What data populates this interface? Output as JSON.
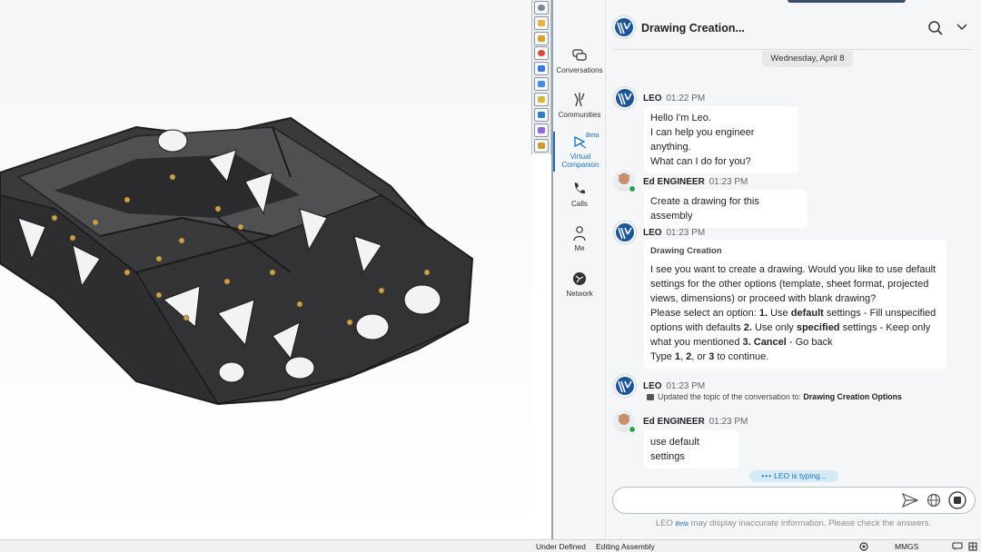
{
  "colors": {
    "accent": "#1f6fb8",
    "logo": "#1c5598",
    "online": "#2ea44f",
    "bubble": "#ffffff",
    "panel": "#f5f6f7"
  },
  "taskbar": {
    "icons": [
      "home-icon",
      "folder-icon",
      "parts-icon",
      "appearance-icon",
      "view-icon",
      "display-icon",
      "custom-props-icon",
      "house-icon",
      "tools-icon",
      "library-icon"
    ]
  },
  "nav": {
    "items": [
      {
        "label": "Conversations",
        "icon": "chat-icon"
      },
      {
        "label": "Communities",
        "icon": "communities-icon"
      },
      {
        "label_line1": "Virtual",
        "label_line2": "Companion",
        "icon": "companion-icon",
        "badge": "Beta"
      },
      {
        "label": "Calls",
        "icon": "phone-icon"
      },
      {
        "label": "Me",
        "icon": "person-icon"
      },
      {
        "label": "Network",
        "icon": "network-icon"
      }
    ]
  },
  "header": {
    "title": "Drawing Creation...",
    "search_icon": "search-icon",
    "menu_icon": "chevron-down-icon"
  },
  "date_divider": "Wednesday, April 8",
  "messages": [
    {
      "sender": "LEO",
      "time": "01:22 PM",
      "lines": [
        "Hello I'm Leo.",
        "I can help you engineer anything.",
        "What can I do for you?"
      ]
    },
    {
      "sender": "Ed ENGINEER",
      "time": "01:23 PM",
      "text": "Create a drawing for this assembly"
    },
    {
      "sender": "LEO",
      "time": "01:23 PM",
      "label": "Drawing Creation",
      "p1": "I see you want to create a drawing. Would you like to use default settings for the other options (template, sheet format, projected views, dimensions) or proceed with blank drawing?",
      "p2a": "Please select an option: ",
      "p2b": "1.",
      "p2c": " Use ",
      "p2d": "default",
      "p2e": " settings - Fill unspecified options with defaults ",
      "p2f": "2.",
      "p2g": " Use only ",
      "p2h": "specified",
      "p2i": " settings - Keep only what you mentioned ",
      "p2j": "3. Cancel",
      "p2k": " - Go back",
      "p3a": "Type ",
      "p3b": "1",
      "p3c": ", ",
      "p3d": "2",
      "p3e": ", or ",
      "p3f": "3",
      "p3g": " to continue."
    },
    {
      "sender": "LEO",
      "time": "01:23 PM",
      "topic_prefix": "Updated the topic of the conversation to: ",
      "topic": "Drawing Creation Options"
    },
    {
      "sender": "Ed ENGINEER",
      "time": "01:23 PM",
      "text": "use default settings"
    }
  ],
  "typing": {
    "dots": "•••",
    "text": "LEO is typing..."
  },
  "input": {
    "placeholder": ""
  },
  "disclaimer": {
    "name": "LEO",
    "badge": "Beta",
    "text": " may display inaccurate information. Please check the answers."
  },
  "status": {
    "state": "Under Defined",
    "mode": "Editing Assembly",
    "units": "MMGS"
  }
}
